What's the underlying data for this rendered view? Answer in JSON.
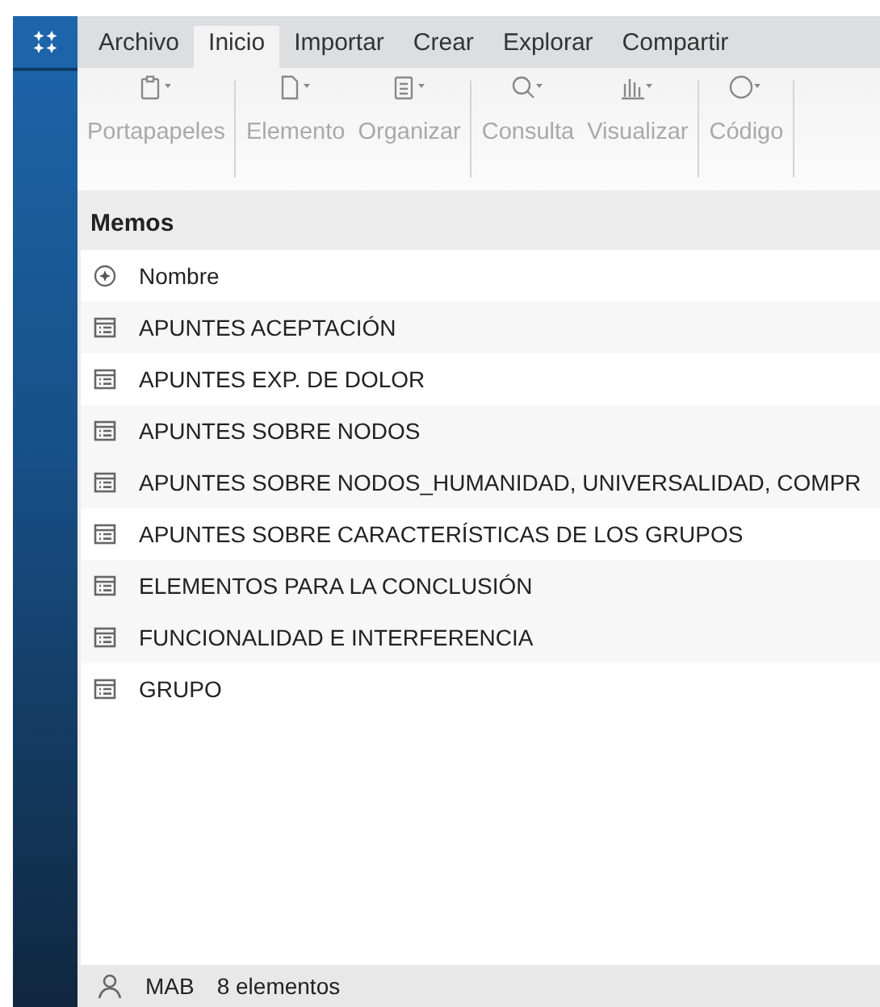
{
  "menu_tabs": [
    {
      "label": "Archivo",
      "selected": false
    },
    {
      "label": "Inicio",
      "selected": true
    },
    {
      "label": "Importar",
      "selected": false
    },
    {
      "label": "Crear",
      "selected": false
    },
    {
      "label": "Explorar",
      "selected": false
    },
    {
      "label": "Compartir",
      "selected": false
    }
  ],
  "ribbon_groups": [
    [
      {
        "label": "Portapapeles",
        "disabled": true
      }
    ],
    [
      {
        "label": "Elemento",
        "disabled": true
      },
      {
        "label": "Organizar",
        "disabled": true
      }
    ],
    [
      {
        "label": "Consulta",
        "disabled": true
      },
      {
        "label": "Visualizar",
        "disabled": true
      }
    ],
    [
      {
        "label": "Código",
        "disabled": true
      }
    ]
  ],
  "panel": {
    "title": "Memos",
    "column_header": "Nombre",
    "rows": [
      {
        "name": "APUNTES ACEPTACIÓN"
      },
      {
        "name": "APUNTES EXP. DE DOLOR"
      },
      {
        "name": "APUNTES SOBRE NODOS"
      },
      {
        "name": "APUNTES SOBRE NODOS_HUMANIDAD, UNIVERSALIDAD, COMPR"
      },
      {
        "name": "APUNTES SOBRE CARACTERÍSTICAS DE LOS GRUPOS"
      },
      {
        "name": "ELEMENTOS PARA LA CONCLUSIÓN"
      },
      {
        "name": "FUNCIONALIDAD E INTERFERENCIA"
      },
      {
        "name": "GRUPO"
      }
    ]
  },
  "status_bar": {
    "user": "MAB",
    "count": "8 elementos"
  }
}
